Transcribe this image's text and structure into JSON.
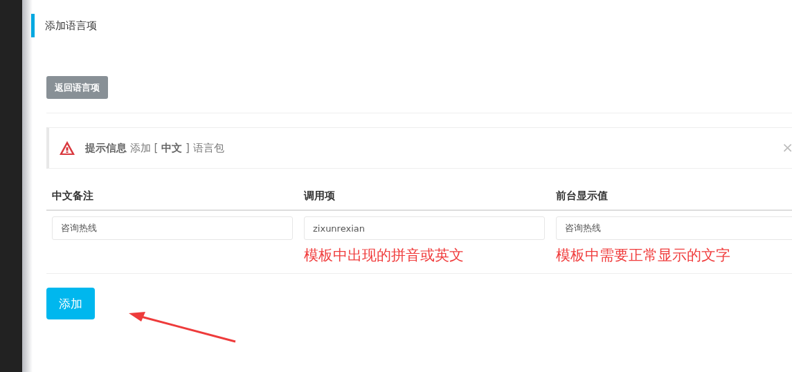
{
  "page_title": "添加语言项",
  "back_button": "返回语言项",
  "alert": {
    "title": "提示信息",
    "text_before": "添加 [",
    "language": "中文",
    "text_after": "] 语言包",
    "close": "×"
  },
  "table": {
    "columns": [
      "中文备注",
      "调用项",
      "前台显示值"
    ],
    "row": {
      "values": [
        "咨询热线",
        "zixunrexian",
        "咨询热线"
      ]
    },
    "notes": [
      "模板中出现的拼音或英文",
      "模板中需要正常显示的文字"
    ]
  },
  "submit_button": "添加"
}
